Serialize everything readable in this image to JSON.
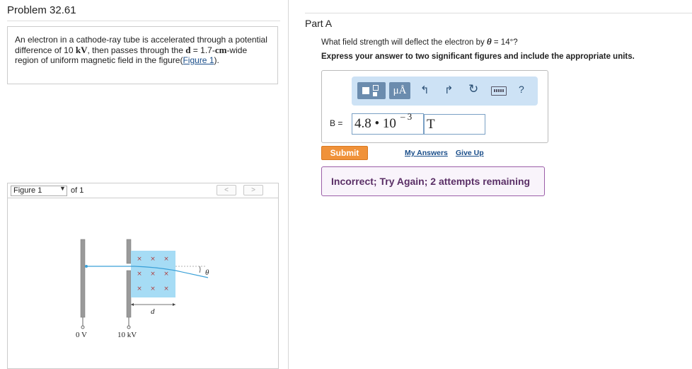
{
  "problem": {
    "title": "Problem 32.61",
    "text_part1": "An electron in a cathode-ray tube is accelerated through a potential difference of 10 ",
    "text_kv": "kV",
    "text_part2": ", then passes through the ",
    "text_d": "d",
    "text_part3": " = 1.7-",
    "text_cm": "cm",
    "text_part4": "-wide region of uniform magnetic field in the figure(",
    "figure_link": "Figure 1",
    "text_part5": ")."
  },
  "figure": {
    "select_value": "Figure 1",
    "of_label": "of 1",
    "prev_label": "<",
    "next_label": ">",
    "label_d": "d",
    "label_theta": "θ",
    "label_0v": "0 V",
    "label_10kv": "10 kV",
    "field_mark": "×"
  },
  "part": {
    "title": "Part A",
    "question_prefix": "What field strength will deflect the electron by ",
    "question_theta": "θ",
    "question_suffix": " = 14°?",
    "instruction": "Express your answer to two significant figures and include the appropriate units."
  },
  "toolbar": {
    "units_label": "μÅ",
    "undo_icon": "↰",
    "redo_icon": "↱",
    "reset_icon": "↻",
    "help_label": "?"
  },
  "answer": {
    "variable_label": "B =",
    "value": "4.8 • 10",
    "exponent": "– 3",
    "unit": "T"
  },
  "actions": {
    "submit_label": "Submit",
    "my_answers_label": "My Answers",
    "give_up_label": "Give Up"
  },
  "feedback": {
    "text": "Incorrect; Try Again; 2 attempts remaining"
  },
  "colors": {
    "submit": "#f0923a",
    "toolbar": "#cde2f5",
    "feedback_border": "#9b5ea8",
    "field_region": "#a6dcf5"
  }
}
